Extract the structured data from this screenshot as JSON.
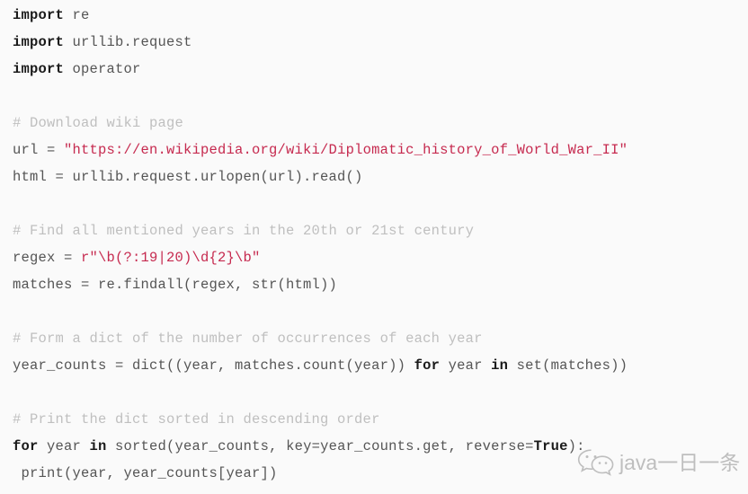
{
  "document": {
    "type": "python-code-snippet",
    "language": "Python",
    "background_color": "#fafafa",
    "colors": {
      "plain": "#555555",
      "keyword": "#1a1a1a",
      "string": "#c62a4f",
      "comment": "#bfbfbf",
      "watermark": "#9a9a9a"
    }
  },
  "code": {
    "lines": [
      {
        "id": "line-1",
        "tokens": [
          {
            "type": "kw",
            "text": "import"
          },
          {
            "type": "plain",
            "text": " re"
          }
        ]
      },
      {
        "id": "line-2",
        "tokens": [
          {
            "type": "kw",
            "text": "import"
          },
          {
            "type": "plain",
            "text": " urllib.request"
          }
        ]
      },
      {
        "id": "line-3",
        "tokens": [
          {
            "type": "kw",
            "text": "import"
          },
          {
            "type": "plain",
            "text": " operator"
          }
        ]
      },
      {
        "id": "line-4",
        "tokens": []
      },
      {
        "id": "line-5",
        "tokens": [
          {
            "type": "comment",
            "text": "# Download wiki page"
          }
        ]
      },
      {
        "id": "line-6",
        "tokens": [
          {
            "type": "plain",
            "text": "url = "
          },
          {
            "type": "str",
            "text": "\"https://en.wikipedia.org/wiki/Diplomatic_history_of_World_War_II\""
          }
        ]
      },
      {
        "id": "line-7",
        "tokens": [
          {
            "type": "plain",
            "text": "html = urllib.request.urlopen(url).read()"
          }
        ]
      },
      {
        "id": "line-8",
        "tokens": []
      },
      {
        "id": "line-9",
        "tokens": [
          {
            "type": "comment",
            "text": "# Find all mentioned years in the 20th or 21st century"
          }
        ]
      },
      {
        "id": "line-10",
        "tokens": [
          {
            "type": "plain",
            "text": "regex = "
          },
          {
            "type": "str",
            "text": "r\"\\b(?:19|20)\\d{2}\\b\""
          }
        ]
      },
      {
        "id": "line-11",
        "tokens": [
          {
            "type": "plain",
            "text": "matches = re.findall(regex, str(html))"
          }
        ]
      },
      {
        "id": "line-12",
        "tokens": []
      },
      {
        "id": "line-13",
        "tokens": [
          {
            "type": "comment",
            "text": "# Form a dict of the number of occurrences of each year"
          }
        ]
      },
      {
        "id": "line-14",
        "tokens": [
          {
            "type": "plain",
            "text": "year_counts = dict((year, matches.count(year)) "
          },
          {
            "type": "kw",
            "text": "for"
          },
          {
            "type": "plain",
            "text": " year "
          },
          {
            "type": "kw",
            "text": "in"
          },
          {
            "type": "plain",
            "text": " set(matches))"
          }
        ]
      },
      {
        "id": "line-15",
        "tokens": []
      },
      {
        "id": "line-16",
        "tokens": [
          {
            "type": "comment",
            "text": "# Print the dict sorted in descending order"
          }
        ]
      },
      {
        "id": "line-17",
        "tokens": [
          {
            "type": "kw",
            "text": "for"
          },
          {
            "type": "plain",
            "text": " year "
          },
          {
            "type": "kw",
            "text": "in"
          },
          {
            "type": "plain",
            "text": " sorted(year_counts, key=year_counts.get, reverse="
          },
          {
            "type": "kw",
            "text": "True"
          },
          {
            "type": "plain",
            "text": "):"
          }
        ]
      },
      {
        "id": "line-18",
        "tokens": [
          {
            "type": "plain",
            "text": " print(year, year_counts[year])"
          }
        ]
      }
    ]
  },
  "watermark": {
    "icon": "wechat-icon",
    "text": "java一日一条"
  }
}
